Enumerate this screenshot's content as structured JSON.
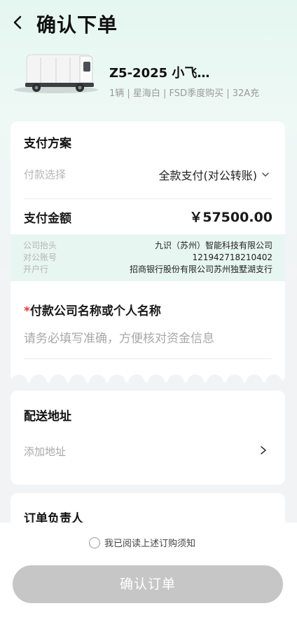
{
  "header": {
    "title": "确认下单"
  },
  "product": {
    "name": "Z5-2025 小飞…",
    "spec": "1辆 | 星海白 | FSD季度购买 | 32A充"
  },
  "payment": {
    "title": "支付方案",
    "method_label": "付款选择",
    "method_value": "全款支付(对公转账)",
    "amount_label": "支付金额",
    "amount_value": "￥57500.00",
    "account": {
      "company_label": "公司抬头",
      "company_value": "九识（苏州）智能科技有限公司",
      "account_label": "对公账号",
      "account_value": "121942718210402",
      "bank_label": "开户行",
      "bank_value": "招商银行股份有限公司苏州独墅湖支行"
    },
    "payer_label": "付款公司名称或个人名称",
    "payer_required_mark": "*",
    "payer_placeholder": "请务必填写准确，方便核对资金信息"
  },
  "address": {
    "title": "配送地址",
    "placeholder": "添加地址"
  },
  "owner": {
    "title": "订单负责人"
  },
  "footer": {
    "agree_text": "我已阅读上述订购须知",
    "confirm_label": "确认订单"
  }
}
